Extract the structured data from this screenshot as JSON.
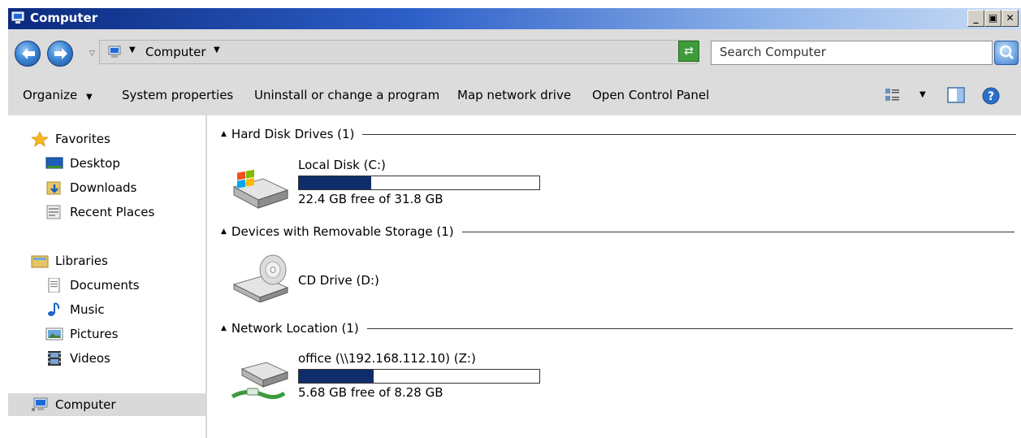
{
  "window": {
    "title": "Computer"
  },
  "address": {
    "location": "Computer"
  },
  "search": {
    "placeholder": "Search Computer"
  },
  "toolbar": {
    "organize": "Organize",
    "system_properties": "System properties",
    "uninstall": "Uninstall or change a program",
    "map_drive": "Map network drive",
    "control_panel": "Open Control Panel"
  },
  "sidebar": {
    "favorites": "Favorites",
    "desktop": "Desktop",
    "downloads": "Downloads",
    "recent": "Recent Places",
    "libraries": "Libraries",
    "documents": "Documents",
    "music": "Music",
    "pictures": "Pictures",
    "videos": "Videos",
    "computer": "Computer"
  },
  "groups": {
    "hdd": {
      "header": "Hard Disk Drives (1)",
      "drive_name": "Local Disk (C:)",
      "space": "22.4 GB free of 31.8 GB",
      "used_fraction": 0.3
    },
    "removable": {
      "header": "Devices with Removable Storage (1)",
      "drive_name": "CD Drive (D:)"
    },
    "network": {
      "header": "Network Location (1)",
      "drive_name": "office (\\\\192.168.112.10) (Z:)",
      "space": "5.68 GB free of 8.28 GB",
      "used_fraction": 0.31
    }
  },
  "colors": {
    "bar_fill": "#0f2d6b",
    "titlebar_start": "#0b2a7e",
    "toolbar_bg": "#dcdcdc"
  }
}
